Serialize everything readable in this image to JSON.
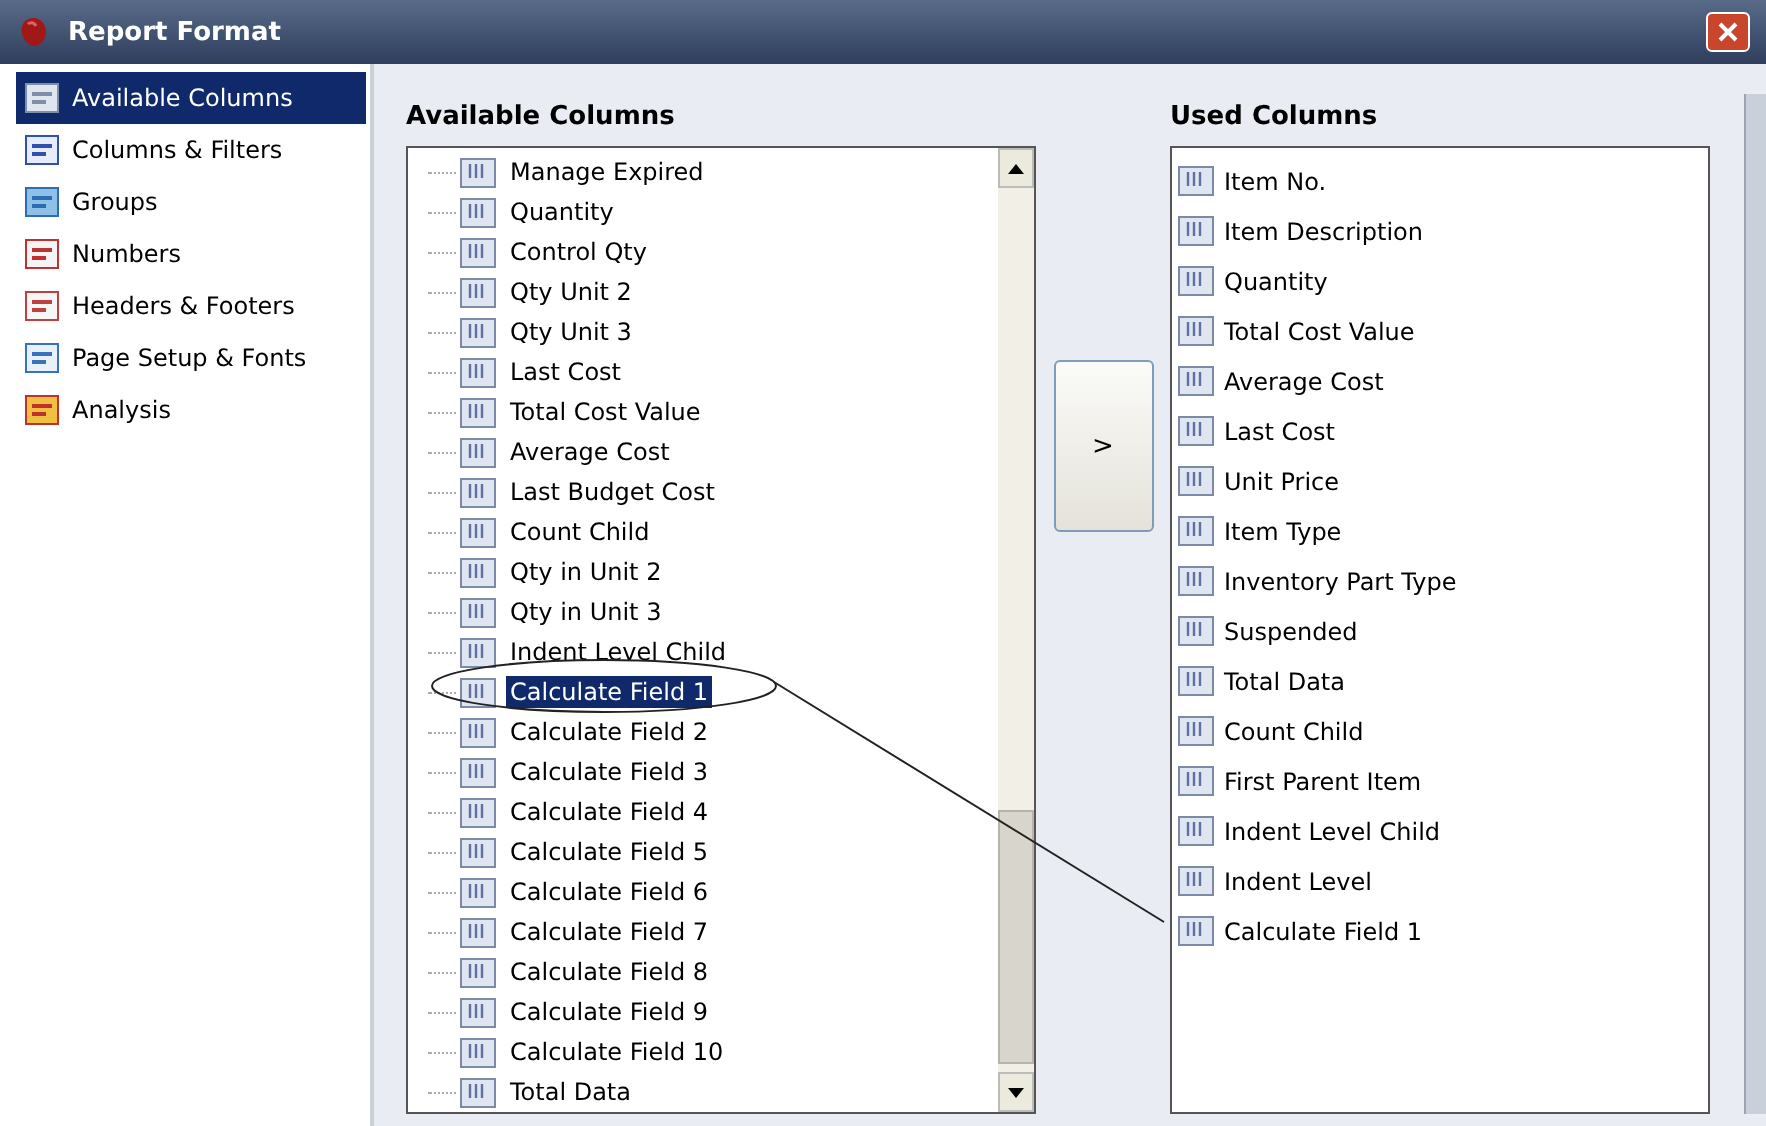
{
  "window": {
    "title": "Report Format"
  },
  "sidebar": {
    "items": [
      {
        "label": "Available Columns",
        "selected": true
      },
      {
        "label": "Columns & Filters",
        "selected": false
      },
      {
        "label": "Groups",
        "selected": false
      },
      {
        "label": "Numbers",
        "selected": false
      },
      {
        "label": "Headers & Footers",
        "selected": false
      },
      {
        "label": "Page Setup & Fonts",
        "selected": false
      },
      {
        "label": "Analysis",
        "selected": false
      }
    ]
  },
  "available": {
    "heading": "Available Columns",
    "items": [
      {
        "label": "Manage Expired",
        "selected": false
      },
      {
        "label": "Quantity",
        "selected": false
      },
      {
        "label": "Control Qty",
        "selected": false
      },
      {
        "label": "Qty Unit 2",
        "selected": false
      },
      {
        "label": "Qty Unit 3",
        "selected": false
      },
      {
        "label": "Last Cost",
        "selected": false
      },
      {
        "label": "Total Cost Value",
        "selected": false
      },
      {
        "label": "Average Cost",
        "selected": false
      },
      {
        "label": "Last Budget Cost",
        "selected": false
      },
      {
        "label": "Count Child",
        "selected": false
      },
      {
        "label": "Qty in Unit 2",
        "selected": false
      },
      {
        "label": "Qty in Unit 3",
        "selected": false
      },
      {
        "label": "Indent Level Child",
        "selected": false
      },
      {
        "label": "Calculate Field 1",
        "selected": true
      },
      {
        "label": "Calculate Field 2",
        "selected": false
      },
      {
        "label": "Calculate Field 3",
        "selected": false
      },
      {
        "label": "Calculate Field 4",
        "selected": false
      },
      {
        "label": "Calculate Field 5",
        "selected": false
      },
      {
        "label": "Calculate Field 6",
        "selected": false
      },
      {
        "label": "Calculate Field 7",
        "selected": false
      },
      {
        "label": "Calculate Field 8",
        "selected": false
      },
      {
        "label": "Calculate Field 9",
        "selected": false
      },
      {
        "label": "Calculate Field 10",
        "selected": false
      },
      {
        "label": "Total Data",
        "selected": false
      }
    ]
  },
  "move_button": {
    "label": ">"
  },
  "used": {
    "heading": "Used Columns",
    "items": [
      "Item No.",
      "Item Description",
      "Quantity",
      "Total Cost Value",
      "Average Cost",
      "Last Cost",
      "Unit Price",
      "Item Type",
      "Inventory Part Type",
      "Suspended",
      "Total Data",
      "Count Child",
      "First Parent Item",
      "Indent Level Child",
      "Indent Level",
      "Calculate Field 1"
    ]
  }
}
